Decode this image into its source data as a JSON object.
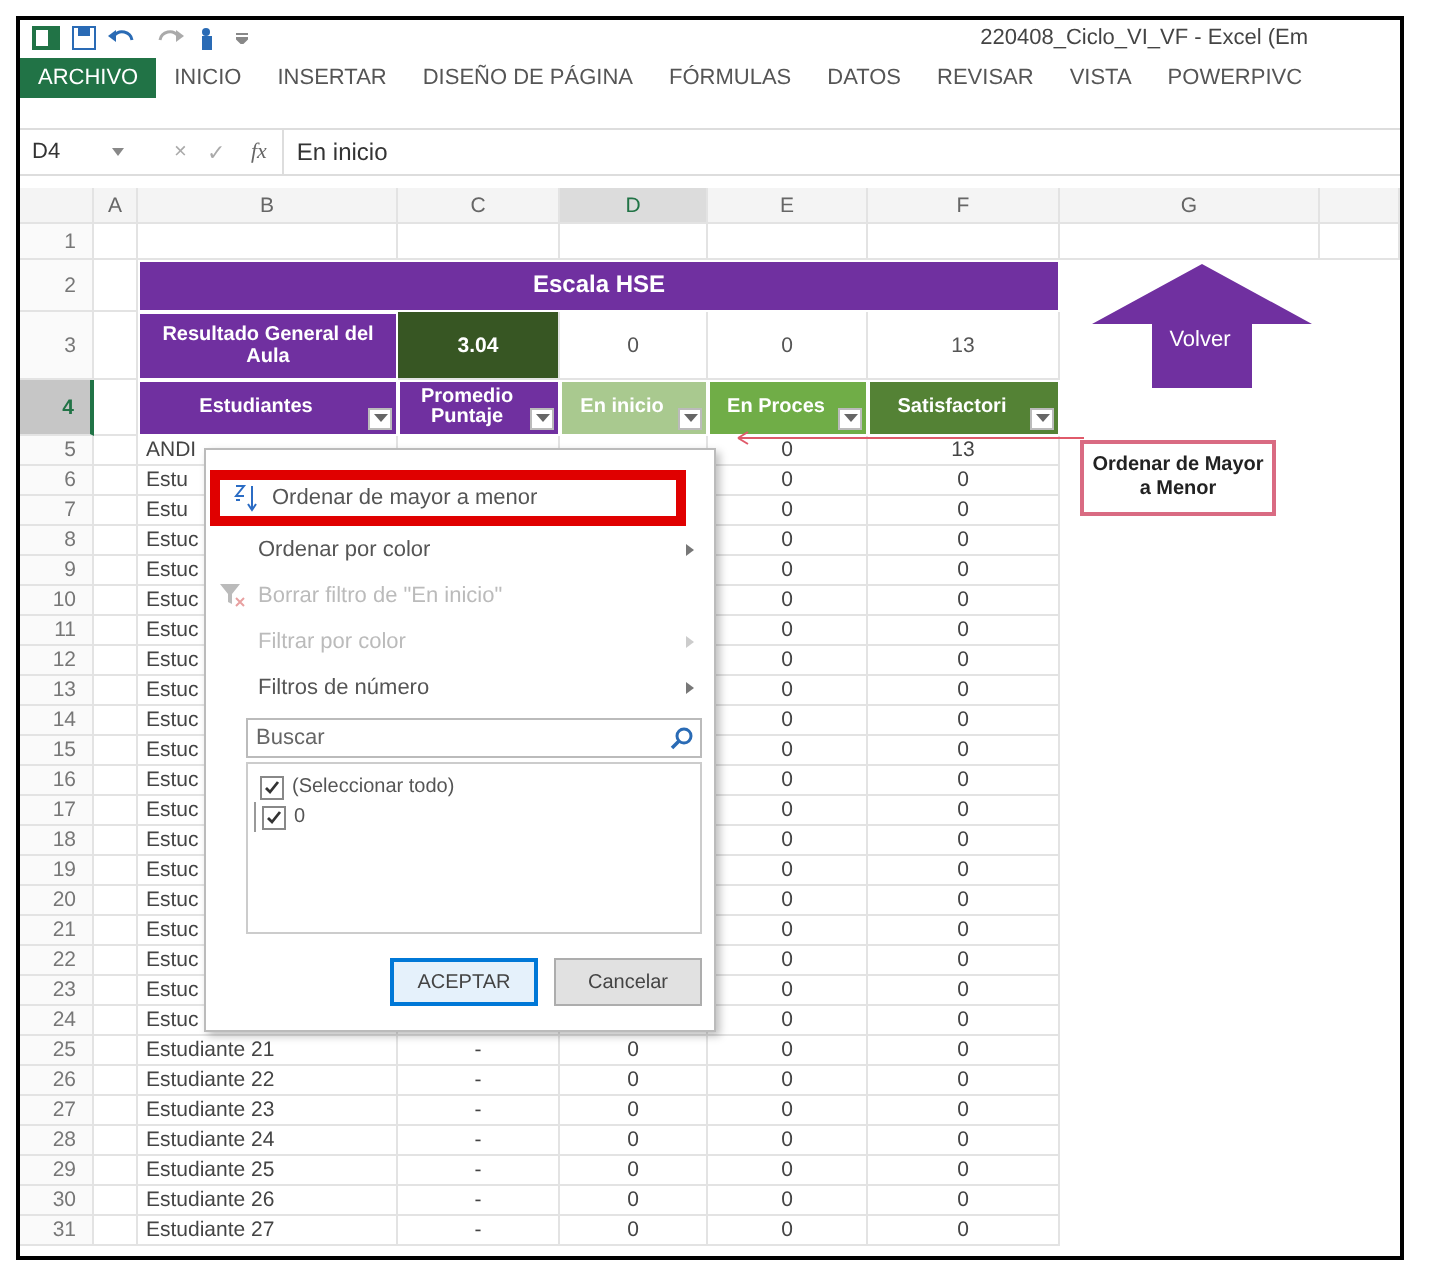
{
  "window": {
    "title": "220408_Ciclo_VI_VF - Excel (Em"
  },
  "ribbon_tabs": [
    {
      "label": "ARCHIVO",
      "selected": true
    },
    {
      "label": "INICIO",
      "selected": false
    },
    {
      "label": "INSERTAR",
      "selected": false
    },
    {
      "label": "DISEÑO DE PÁGINA",
      "selected": false
    },
    {
      "label": "FÓRMULAS",
      "selected": false
    },
    {
      "label": "DATOS",
      "selected": false
    },
    {
      "label": "REVISAR",
      "selected": false
    },
    {
      "label": "VISTA",
      "selected": false
    },
    {
      "label": "POWERPIVC",
      "selected": false
    }
  ],
  "formula_bar": {
    "name_box": "D4",
    "cancel": "×",
    "enter": "✓",
    "function": "fx",
    "formula": "En inicio"
  },
  "columns": [
    {
      "label": "A",
      "selected": false
    },
    {
      "label": "B",
      "selected": false
    },
    {
      "label": "C",
      "selected": false
    },
    {
      "label": "D",
      "selected": true
    },
    {
      "label": "E",
      "selected": false
    },
    {
      "label": "F",
      "selected": false
    },
    {
      "label": "G",
      "selected": false
    }
  ],
  "rows": [
    {
      "number": "1",
      "selected": false
    },
    {
      "number": "2",
      "selected": false
    },
    {
      "number": "3",
      "selected": false
    },
    {
      "number": "4",
      "selected": true
    },
    {
      "number": "5",
      "selected": false
    },
    {
      "number": "6",
      "selected": false
    },
    {
      "number": "7",
      "selected": false
    },
    {
      "number": "8",
      "selected": false
    },
    {
      "number": "9",
      "selected": false
    },
    {
      "number": "10",
      "selected": false
    },
    {
      "number": "11",
      "selected": false
    },
    {
      "number": "12",
      "selected": false
    },
    {
      "number": "13",
      "selected": false
    },
    {
      "number": "14",
      "selected": false
    },
    {
      "number": "15",
      "selected": false
    },
    {
      "number": "16",
      "selected": false
    },
    {
      "number": "17",
      "selected": false
    },
    {
      "number": "18",
      "selected": false
    },
    {
      "number": "19",
      "selected": false
    },
    {
      "number": "20",
      "selected": false
    },
    {
      "number": "21",
      "selected": false
    },
    {
      "number": "22",
      "selected": false
    },
    {
      "number": "23",
      "selected": false
    },
    {
      "number": "24",
      "selected": false
    },
    {
      "number": "25",
      "selected": false
    },
    {
      "number": "26",
      "selected": false
    },
    {
      "number": "27",
      "selected": false
    },
    {
      "number": "28",
      "selected": false
    },
    {
      "number": "29",
      "selected": false
    },
    {
      "number": "30",
      "selected": false
    },
    {
      "number": "31",
      "selected": false
    }
  ],
  "report": {
    "title": "Escala HSE",
    "summary_label": "Resultado General del Aula",
    "summary_values": [
      {
        "value": "3.04",
        "color": "#375623"
      },
      {
        "value": "0",
        "color": "#ffffff"
      },
      {
        "value": "0",
        "color": "#ffffff"
      },
      {
        "value": "13",
        "color": "#ffffff"
      }
    ],
    "headers": [
      {
        "label": "Estudiantes",
        "color": "#7030a0"
      },
      {
        "label": "Promedio Puntaje",
        "color": "#7030a0"
      },
      {
        "label": "En inicio",
        "color": "#a9c98f"
      },
      {
        "label": "En Proces",
        "color": "#70ad47"
      },
      {
        "label": "Satisfactori",
        "color": "#548235"
      }
    ],
    "students": [
      {
        "name": "ANDI",
        "cells": [
          "",
          "",
          "0",
          "13"
        ]
      },
      {
        "name": "Estu",
        "cells": [
          "",
          "",
          "0",
          "0"
        ]
      },
      {
        "name": "Estu",
        "cells": [
          "",
          "",
          "0",
          "0"
        ]
      },
      {
        "name": "Estuc",
        "cells": [
          "",
          "",
          "0",
          "0"
        ]
      },
      {
        "name": "Estuc",
        "cells": [
          "",
          "",
          "0",
          "0"
        ]
      },
      {
        "name": "Estuc",
        "cells": [
          "",
          "",
          "0",
          "0"
        ]
      },
      {
        "name": "Estuc",
        "cells": [
          "",
          "",
          "0",
          "0"
        ]
      },
      {
        "name": "Estuc",
        "cells": [
          "",
          "",
          "0",
          "0"
        ]
      },
      {
        "name": "Estuc",
        "cells": [
          "",
          "",
          "0",
          "0"
        ]
      },
      {
        "name": "Estuc",
        "cells": [
          "",
          "",
          "0",
          "0"
        ]
      },
      {
        "name": "Estuc",
        "cells": [
          "",
          "",
          "0",
          "0"
        ]
      },
      {
        "name": "Estuc",
        "cells": [
          "",
          "",
          "0",
          "0"
        ]
      },
      {
        "name": "Estuc",
        "cells": [
          "",
          "",
          "0",
          "0"
        ]
      },
      {
        "name": "Estuc",
        "cells": [
          "",
          "",
          "0",
          "0"
        ]
      },
      {
        "name": "Estuc",
        "cells": [
          "",
          "",
          "0",
          "0"
        ]
      },
      {
        "name": "Estuc",
        "cells": [
          "",
          "",
          "0",
          "0"
        ]
      },
      {
        "name": "Estuc",
        "cells": [
          "",
          "",
          "0",
          "0"
        ]
      },
      {
        "name": "Estuc",
        "cells": [
          "",
          "",
          "0",
          "0"
        ]
      },
      {
        "name": "Estuc",
        "cells": [
          "",
          "",
          "0",
          "0"
        ]
      },
      {
        "name": "Estuc",
        "cells": [
          "",
          "",
          "0",
          "0"
        ]
      },
      {
        "name": "Estudiante 21",
        "cells": [
          "-",
          "0",
          "0",
          "0"
        ]
      },
      {
        "name": "Estudiante 22",
        "cells": [
          "-",
          "0",
          "0",
          "0"
        ]
      },
      {
        "name": "Estudiante 23",
        "cells": [
          "-",
          "0",
          "0",
          "0"
        ]
      },
      {
        "name": "Estudiante 24",
        "cells": [
          "-",
          "0",
          "0",
          "0"
        ]
      },
      {
        "name": "Estudiante 25",
        "cells": [
          "-",
          "0",
          "0",
          "0"
        ]
      },
      {
        "name": "Estudiante 26",
        "cells": [
          "-",
          "0",
          "0",
          "0"
        ]
      },
      {
        "name": "Estudiante 27",
        "cells": [
          "-",
          "0",
          "0",
          "0"
        ]
      }
    ]
  },
  "volver": {
    "label": "Volver"
  },
  "callout": {
    "text": "Ordenar de Mayor a Menor"
  },
  "filter_menu": {
    "items": [
      {
        "label": "Ordenar de mayor a menor",
        "kind": "sort",
        "highlighted": true,
        "disabled": false,
        "submenu": false
      },
      {
        "label": "Ordenar por color",
        "kind": "plain",
        "highlighted": false,
        "disabled": false,
        "submenu": true
      },
      {
        "label": "Borrar filtro de \"En inicio\"",
        "kind": "clear",
        "highlighted": false,
        "disabled": true,
        "submenu": false
      },
      {
        "label": "Filtrar por color",
        "kind": "plain",
        "highlighted": false,
        "disabled": true,
        "submenu": true
      },
      {
        "label": "Filtros de número",
        "kind": "plain",
        "highlighted": false,
        "disabled": false,
        "submenu": true
      }
    ],
    "search": {
      "placeholder": "Buscar"
    },
    "values": [
      {
        "label": "(Seleccionar todo)",
        "checked": true,
        "children": [
          {
            "label": "0",
            "checked": true
          }
        ]
      }
    ],
    "buttons": [
      {
        "label": "ACEPTAR",
        "focused": true
      },
      {
        "label": "Cancelar",
        "focused": false
      }
    ]
  }
}
